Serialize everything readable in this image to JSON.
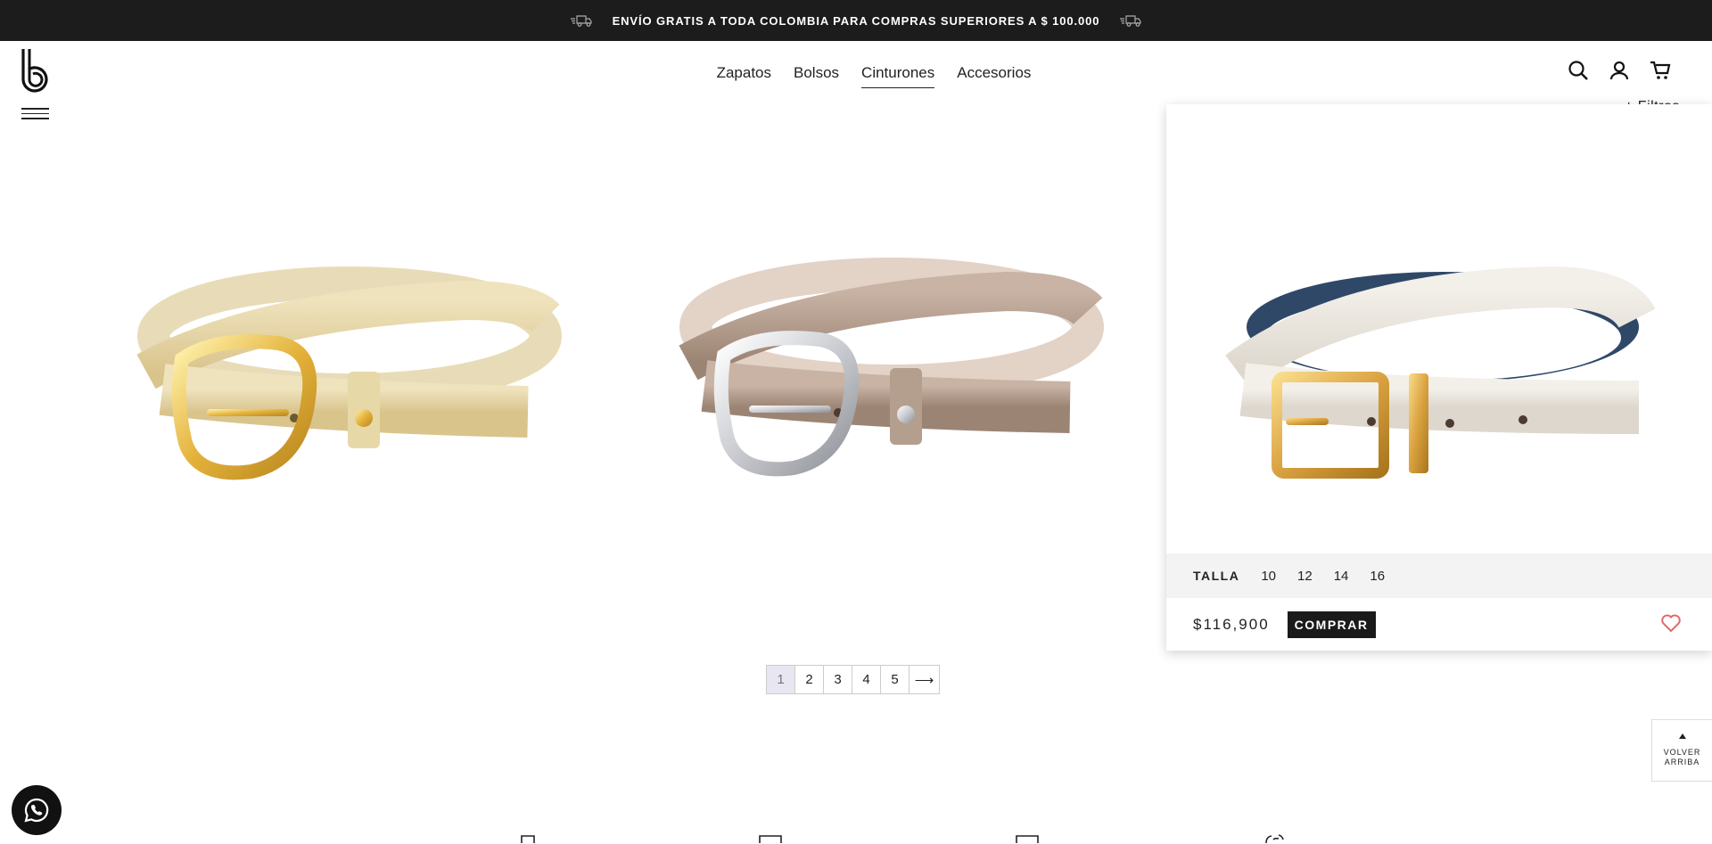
{
  "promo": {
    "text": "ENVÍO GRATIS A TODA COLOMBIA PARA COMPRAS SUPERIORES A $ 100.000"
  },
  "nav": {
    "items": [
      "Zapatos",
      "Bolsos",
      "Cinturones",
      "Accesorios"
    ],
    "active": "Cinturones"
  },
  "filters": {
    "label": "+ Filtros"
  },
  "products": [
    {
      "image": "belt-gold-embossed"
    },
    {
      "image": "belt-taupe-embossed-silver-buckle"
    },
    {
      "image": "belt-white-reversible-blue",
      "sizes_label": "TALLA",
      "sizes": [
        "10",
        "12",
        "14",
        "16"
      ],
      "price": "$116,900",
      "buy_label": "COMPRAR"
    }
  ],
  "pagination": {
    "pages": [
      "1",
      "2",
      "3",
      "4",
      "5"
    ],
    "current": "1",
    "next": "⟶"
  },
  "back_to_top": {
    "line1": "VOLVER",
    "line2": "ARRIBA"
  },
  "colors": {
    "promo_bg": "#1c1c1c",
    "heart": "#e26a6a",
    "page_current_bg": "#e8e6f0"
  },
  "icons": [
    "truck-icon",
    "logo",
    "menu-icon",
    "search-icon",
    "user-icon",
    "cart-icon",
    "heart-icon",
    "whatsapp-icon",
    "arrow-up-icon"
  ]
}
